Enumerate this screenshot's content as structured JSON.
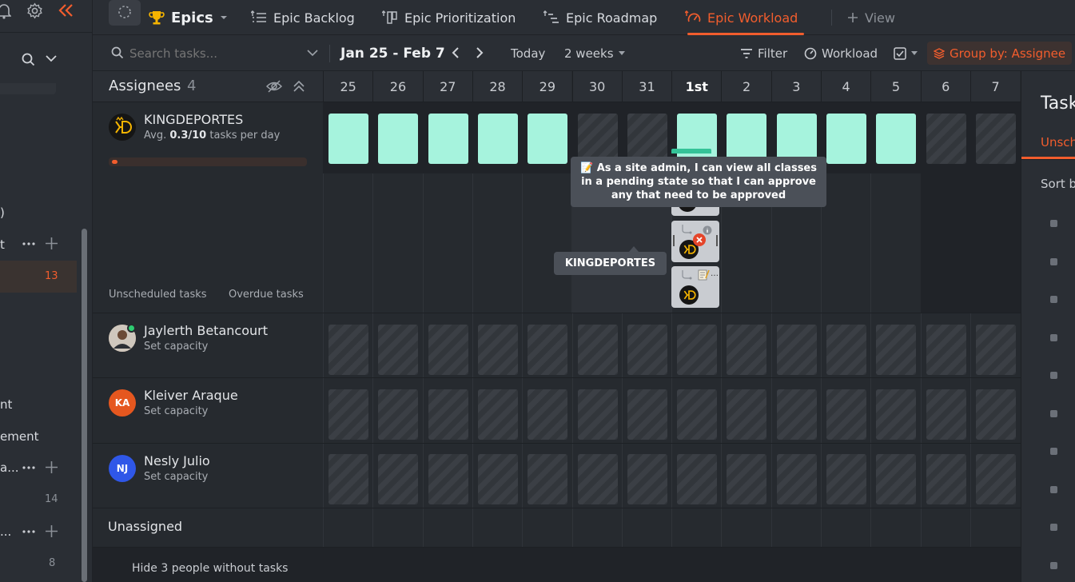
{
  "sidebar": {
    "items": [
      {
        "label": ")"
      },
      {
        "label": "t"
      },
      {
        "label": "nt"
      },
      {
        "label": "ement"
      },
      {
        "label": "a..."
      },
      {
        "label": "..."
      }
    ],
    "counts": [
      "13",
      "14",
      "8"
    ]
  },
  "topbar": {
    "space_label": "Epics",
    "tabs": [
      {
        "label": "Epic Backlog"
      },
      {
        "label": "Epic Prioritization"
      },
      {
        "label": "Epic Roadmap"
      },
      {
        "label": "Epic Workload"
      },
      {
        "label": "View"
      }
    ]
  },
  "toolbar": {
    "search_placeholder": "Search tasks...",
    "date_range": "Jan 25 - Feb 7",
    "today": "Today",
    "period": "2 weeks",
    "filter": "Filter",
    "workload": "Workload",
    "group_by": "Group by: Assignee"
  },
  "grid": {
    "header_title": "Assignees",
    "header_count": "4",
    "days": [
      "25",
      "26",
      "27",
      "28",
      "29",
      "30",
      "31",
      "1st",
      "2",
      "3",
      "4",
      "5",
      "6",
      "7"
    ],
    "today_index": 7,
    "people": [
      {
        "name": "KINGDEPORTES",
        "sub_prefix": "Avg.",
        "sub_value": "0.3/10",
        "sub_suffix": "tasks per day",
        "avatar_text": "KD",
        "avatar_color": "#1b1b1b",
        "capacity_fraction": 0.03
      },
      {
        "name": "Jaylerth Betancourt",
        "sub": "Set capacity",
        "avatar_color": "#b08f73"
      },
      {
        "name": "Kleiver Araque",
        "sub": "Set capacity",
        "avatar_text": "KA",
        "avatar_color": "#e5571f"
      },
      {
        "name": "Nesly Julio",
        "sub": "Set capacity",
        "avatar_text": "NJ",
        "avatar_color": "#2f57e8"
      }
    ],
    "unscheduled_label": "Unscheduled tasks",
    "overdue_label": "Overdue tasks",
    "unassigned_label": "Unassigned",
    "hide_label": "Hide 3 people without tasks"
  },
  "tooltips": {
    "task": "📝 As a site admin, I can view all classes in a pending state so that I can approve any that need to be approved",
    "assignee": "KINGDEPORTES"
  },
  "right_panel": {
    "title": "Task",
    "tab": "Unsch",
    "sort": "Sort b"
  },
  "colors": {
    "accent": "#f25d2d",
    "free_capacity": "#a6f3dd",
    "background": "#2a2e34"
  }
}
